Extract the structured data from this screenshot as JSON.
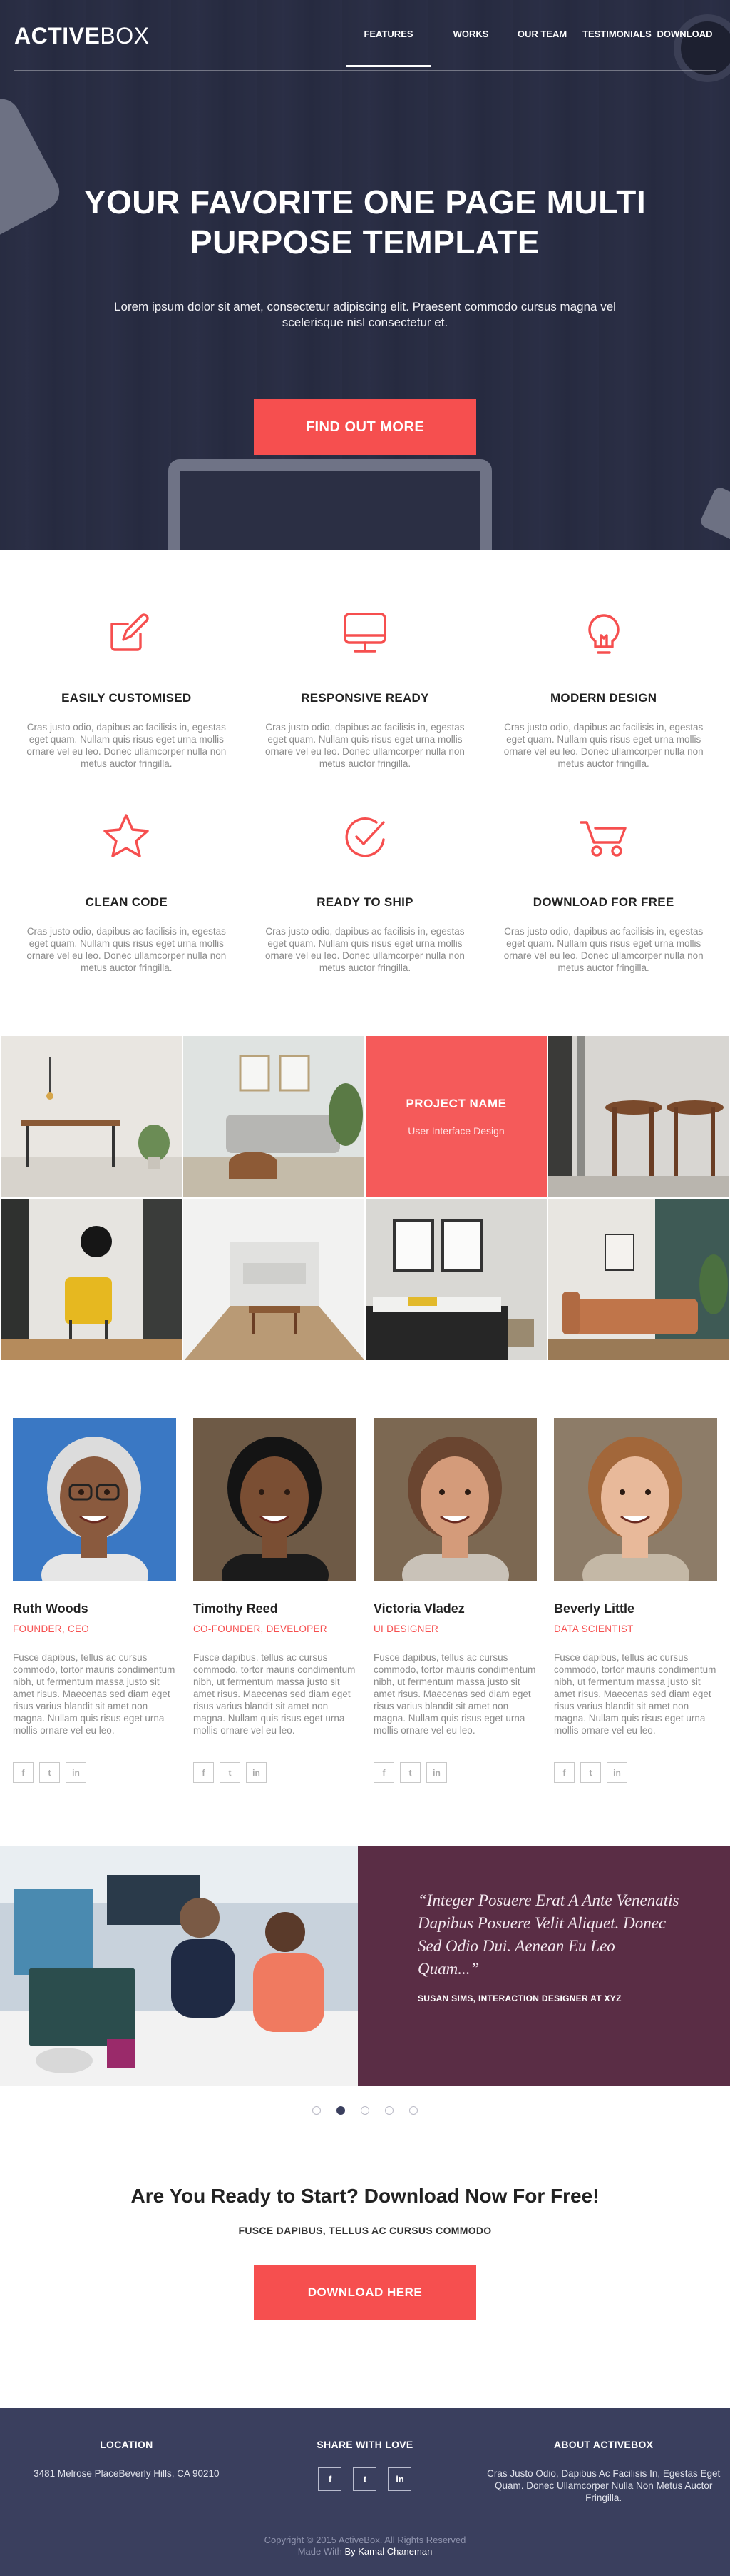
{
  "colors": {
    "accent": "#f64f4f",
    "navy": "#3a3f5e",
    "plum": "#5a2d45"
  },
  "header": {
    "logo_bold": "ACTIVE",
    "logo_light": "BOX",
    "nav": [
      {
        "label": "FEATURES",
        "active": true
      },
      {
        "label": "WORKS"
      },
      {
        "label": "OUR TEAM"
      },
      {
        "label": "TESTIMONIALS"
      },
      {
        "label": "DOWNLOAD"
      }
    ]
  },
  "hero": {
    "title_line1": "YOUR FAVORITE ONE PAGE MULTI",
    "title_line2": "PURPOSE TEMPLATE",
    "subtitle": "Lorem ipsum dolor sit amet, consectetur adipiscing elit. Praesent commodo cursus magna vel scelerisque nisl consectetur et.",
    "button": "FIND OUT MORE"
  },
  "features": [
    {
      "icon": "pencil-icon",
      "title": "EASILY CUSTOMISED",
      "text": "Cras justo odio, dapibus ac facilisis in, egestas eget quam. Nullam quis risus eget urna mollis ornare vel eu leo. Donec ullamcorper nulla non metus auctor fringilla."
    },
    {
      "icon": "monitor-icon",
      "title": "RESPONSIVE READY",
      "text": "Cras justo odio, dapibus ac facilisis in, egestas eget quam. Nullam quis risus eget urna mollis ornare vel eu leo. Donec ullamcorper nulla non metus auctor fringilla."
    },
    {
      "icon": "lightbulb-icon",
      "title": "MODERN DESIGN",
      "text": "Cras justo odio, dapibus ac facilisis in, egestas eget quam. Nullam quis risus eget urna mollis ornare vel eu leo. Donec ullamcorper nulla non metus auctor fringilla."
    },
    {
      "icon": "star-icon",
      "title": "CLEAN CODE",
      "text": "Cras justo odio, dapibus ac facilisis in, egestas eget quam. Nullam quis risus eget urna mollis ornare vel eu leo. Donec ullamcorper nulla non metus auctor fringilla."
    },
    {
      "icon": "check-circle-icon",
      "title": "READY TO SHIP",
      "text": "Cras justo odio, dapibus ac facilisis in, egestas eget quam. Nullam quis risus eget urna mollis ornare vel eu leo. Donec ullamcorper nulla non metus auctor fringilla."
    },
    {
      "icon": "cart-icon",
      "title": "DOWNLOAD FOR FREE",
      "text": "Cras justo odio, dapibus ac facilisis in, egestas eget quam. Nullam quis risus eget urna mollis ornare vel eu leo. Donec ullamcorper nulla non metus auctor fringilla."
    }
  ],
  "works": {
    "project_name": "PROJECT NAME",
    "project_category": "User Interface Design"
  },
  "team": [
    {
      "name": "Ruth Woods",
      "role": "FOUNDER, CEO",
      "bio": "Fusce dapibus, tellus ac cursus commodo, tortor mauris condimentum nibh, ut fermentum massa justo sit amet risus. Maecenas sed diam eget risus varius blandit sit amet non magna. Nullam quis risus eget urna mollis ornare vel eu leo."
    },
    {
      "name": "Timothy Reed",
      "role": "CO-FOUNDER, DEVELOPER",
      "bio": "Fusce dapibus, tellus ac cursus commodo, tortor mauris condimentum nibh, ut fermentum massa justo sit amet risus. Maecenas sed diam eget risus varius blandit sit amet non magna. Nullam quis risus eget urna mollis ornare vel eu leo."
    },
    {
      "name": "Victoria Vladez",
      "role": "UI DESIGNER",
      "bio": "Fusce dapibus, tellus ac cursus commodo, tortor mauris condimentum nibh, ut fermentum massa justo sit amet risus. Maecenas sed diam eget risus varius blandit sit amet non magna. Nullam quis risus eget urna mollis ornare vel eu leo."
    },
    {
      "name": "Beverly Little",
      "role": "DATA SCIENTIST",
      "bio": "Fusce dapibus, tellus ac cursus commodo, tortor mauris condimentum nibh, ut fermentum massa justo sit amet risus. Maecenas sed diam eget risus varius blandit sit amet non magna. Nullam quis risus eget urna mollis ornare vel eu leo."
    }
  ],
  "social_glyphs": {
    "facebook": "f",
    "twitter": "t",
    "linkedin": "in"
  },
  "testimonial": {
    "quote": "“Integer Posuere Erat A Ante Venenatis Dapibus Posuere Velit Aliquet. Donec Sed Odio Dui. Aenean Eu Leo Quam...”",
    "author": "SUSAN SIMS, INTERACTION DESIGNER AT XYZ",
    "slide_count": 5,
    "active_slide": 2
  },
  "cta": {
    "title": "Are You Ready to Start? Download Now For Free!",
    "subtitle": "FUSCE DAPIBUS, TELLUS AC CURSUS COMMODO",
    "button": "DOWNLOAD HERE"
  },
  "footer": {
    "location_title": "LOCATION",
    "location_text": "3481 Melrose PlaceBeverly Hills, CA 90210",
    "share_title": "SHARE WITH LOVE",
    "about_title": "ABOUT ACTIVEBOX",
    "about_text": "Cras Justo Odio, Dapibus Ac Facilisis In, Egestas Eget Quam. Donec Ullamcorper Nulla Non Metus Auctor Fringilla.",
    "copyright": "Copyright © 2015 ActiveBox. All Rights Reserved",
    "made_with": "Made With",
    "author_link": "By Kamal Chaneman"
  }
}
